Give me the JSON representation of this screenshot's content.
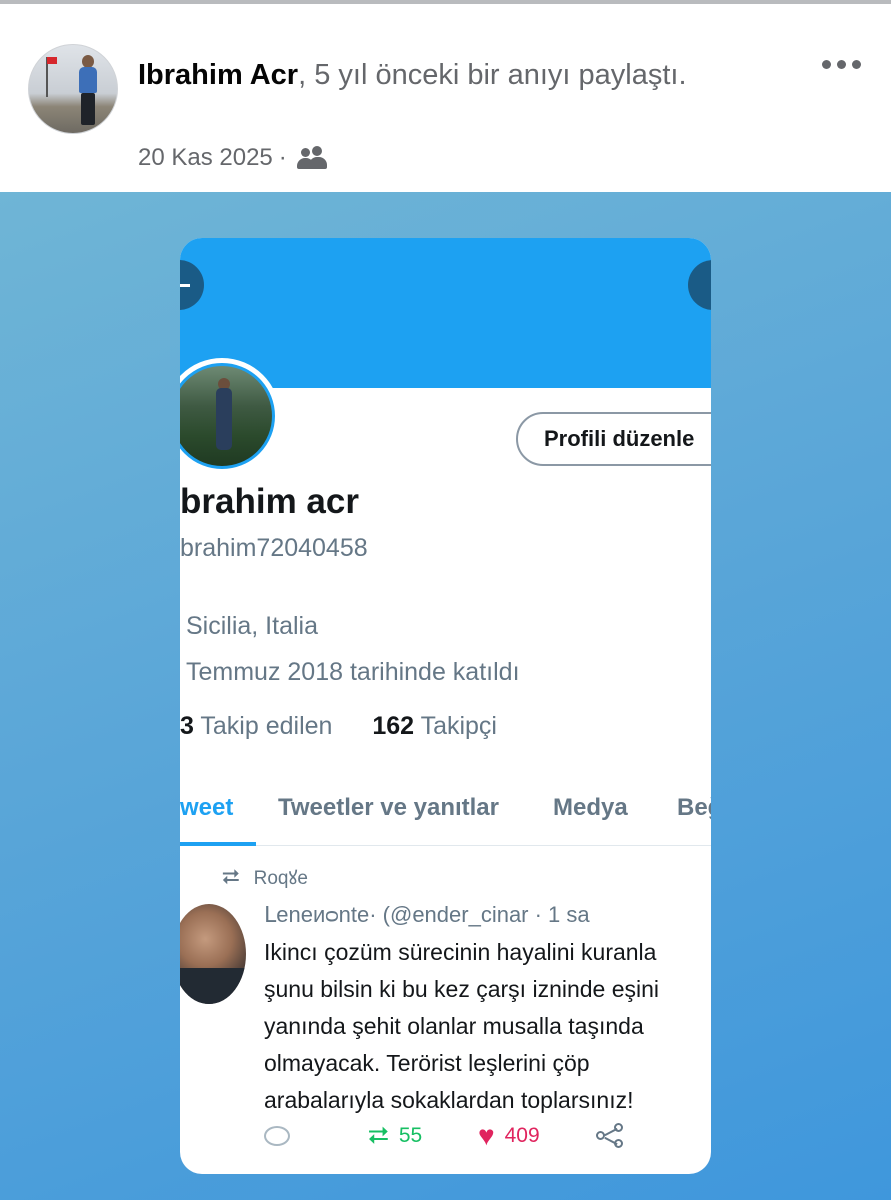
{
  "post": {
    "author": "Ibrahim Acr",
    "action_text": ", 5 yıl önceki bir anıyı paylaştı.",
    "date": "20 Kas 2025",
    "separator": "·",
    "audience_icon": "friends-icon",
    "more_icon": "more-dots-icon"
  },
  "profile": {
    "edit_button": "Profili düzenle",
    "display_name": "brahim acr",
    "handle": "brahim72040458",
    "location": "Sicilia, Italia",
    "joined": "Temmuz 2018 tarihinde katıldı",
    "following_count": "3",
    "following_label": "Takip edilen",
    "followers_count": "162",
    "followers_label": "Takipçi"
  },
  "tabs": [
    {
      "label": "weet"
    },
    {
      "label": "Tweetler ve yanıtlar"
    },
    {
      "label": "Medya"
    },
    {
      "label": "Beğ"
    }
  ],
  "tweet": {
    "retweet_label": "Roqꙋe",
    "header": "ᒪeneᴎᴑnte· (@ender_cinar · 1 sa",
    "lines": [
      "Ikincı çozüm sürecinin hayalini kuranla",
      "şunu bilsin ki bu kez çarşı izninde eşini",
      "yanında şehit olanlar musalla taşında",
      "olmayacak. Terörist leşlerini çöp",
      "arabalarıyla sokaklardan toplarsınız!"
    ],
    "retweets": "55",
    "likes": "409"
  },
  "colors": {
    "twitter_blue": "#1da1f2",
    "retweet_green": "#17bf63",
    "like_pink": "#e0245e"
  }
}
